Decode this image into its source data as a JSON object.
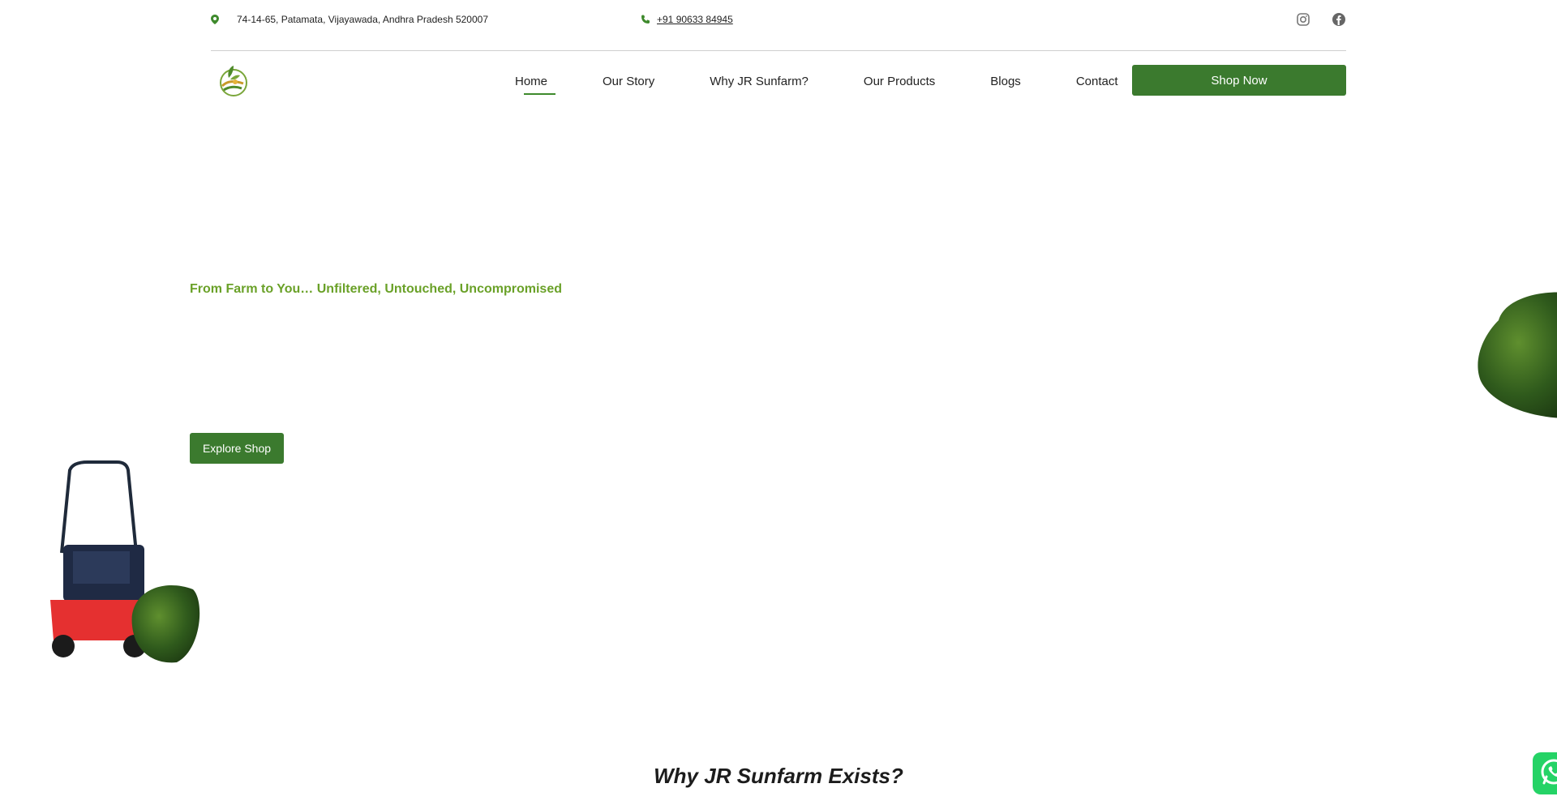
{
  "topbar": {
    "address": "74-14-65, Patamata, Vijayawada, Andhra Pradesh 520007",
    "phone": "+91 90633 84945",
    "social_icons": [
      "instagram-icon",
      "facebook-icon"
    ]
  },
  "nav": {
    "items": [
      {
        "label": "Home",
        "active": true
      },
      {
        "label": "Our Story"
      },
      {
        "label": "Why JR Sunfarm?"
      },
      {
        "label": "Our Products"
      },
      {
        "label": "Blogs"
      },
      {
        "label": "Contact"
      }
    ],
    "cta": "Shop Now"
  },
  "hero": {
    "tagline": "From Farm to You… Unfiltered, Untouched, Uncompromised",
    "button": "Explore Shop"
  },
  "section": {
    "title": "Why JR Sunfarm Exists?"
  },
  "colors": {
    "brand_green": "#3b7a2e",
    "tagline_green": "#6aa128",
    "whatsapp": "#25d366"
  }
}
